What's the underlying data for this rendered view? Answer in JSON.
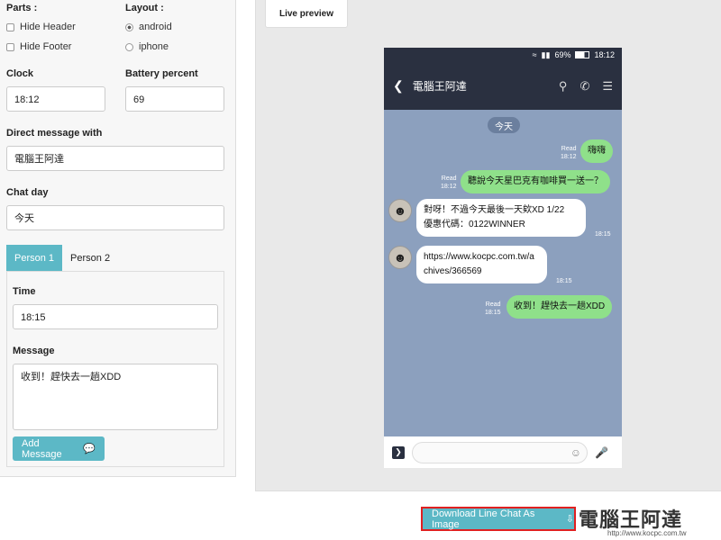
{
  "form": {
    "parts_label": "Parts :",
    "hide_header": "Hide Header",
    "hide_footer": "Hide Footer",
    "layout_label": "Layout :",
    "layout_android": "android",
    "layout_iphone": "iphone",
    "clock_label": "Clock",
    "clock_value": "18:12",
    "battery_label": "Battery percent",
    "battery_value": "69",
    "dm_label": "Direct message with",
    "dm_value": "電腦王阿達",
    "chat_day_label": "Chat day",
    "chat_day_value": "今天",
    "tabs": [
      "Person 1",
      "Person 2"
    ],
    "time_label": "Time",
    "time_value": "18:15",
    "message_label": "Message",
    "message_value": "收到！趕快去一趟XDD",
    "add_button": "Add Message"
  },
  "preview": {
    "tab_label": "Live preview",
    "status_battery": "69%",
    "status_time": "18:12",
    "contact_name": "電腦王阿達",
    "date_pill": "今天",
    "messages": [
      {
        "text": "嗨嗨",
        "read": "Read",
        "time": "18:12"
      },
      {
        "text": "聽說今天星巴克有咖啡買一送一？",
        "read": "Read",
        "time": "18:12"
      },
      {
        "line1": "對呀！不過今天最後一天欸XD 1/22",
        "line2": "優惠代碼：0122WINNER",
        "time": "18:15"
      },
      {
        "line1": "https://www.kocpc.com.tw/a",
        "line2": "chives/366569",
        "time": "18:15"
      },
      {
        "text": "收到！趕快去一趟XDD",
        "read": "Read",
        "time": "18:15"
      }
    ]
  },
  "download_button": "Download Line Chat As Image",
  "watermark": {
    "title": "電腦王阿達",
    "url": "http://www.kocpc.com.tw"
  },
  "colors": {
    "accent": "#5cb8c6",
    "line_green": "#8fe08a",
    "chat_bg": "#8ca0be",
    "header_dark": "#2a3040"
  }
}
